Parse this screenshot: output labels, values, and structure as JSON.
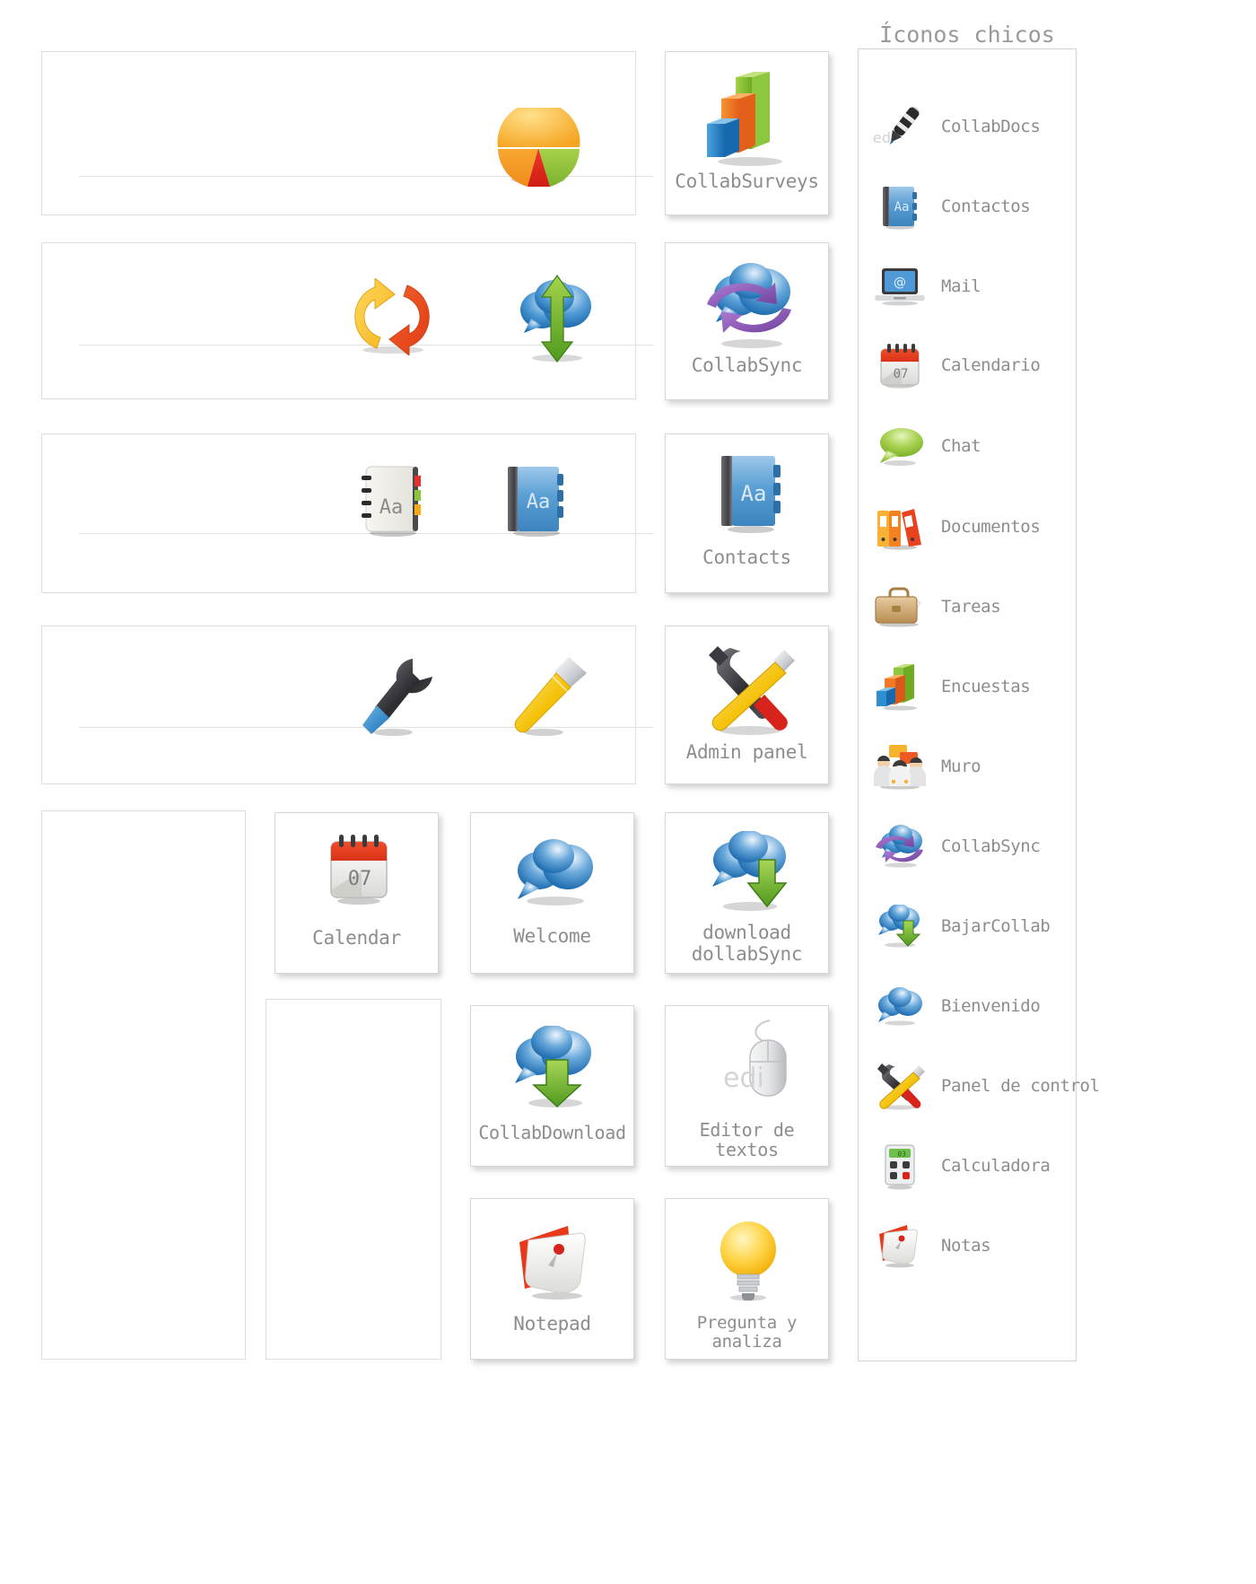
{
  "sidebar": {
    "title": "Íconos chicos",
    "items": [
      {
        "label": "CollabDocs",
        "icon": "pen-icon"
      },
      {
        "label": "Contactos",
        "icon": "address-book-icon"
      },
      {
        "label": "Mail",
        "icon": "laptop-mail-icon"
      },
      {
        "label": "Calendario",
        "icon": "calendar-icon"
      },
      {
        "label": "Chat",
        "icon": "speech-bubble-icon"
      },
      {
        "label": "Documentos",
        "icon": "binders-icon"
      },
      {
        "label": "Tareas",
        "icon": "briefcase-icon"
      },
      {
        "label": "Encuestas",
        "icon": "bar-chart-icon"
      },
      {
        "label": "Muro",
        "icon": "people-group-icon"
      },
      {
        "label": "CollabSync",
        "icon": "cloud-sync-icon"
      },
      {
        "label": "BajarCollab",
        "icon": "cloud-download-icon"
      },
      {
        "label": "Bienvenido",
        "icon": "cloud-icon"
      },
      {
        "label": "Panel de control",
        "icon": "tools-icon"
      },
      {
        "label": "Calculadora",
        "icon": "calculator-icon"
      },
      {
        "label": "Notas",
        "icon": "notes-icon"
      }
    ]
  },
  "rows": [
    {
      "name": "surveys-row",
      "sketch_icons": [
        "pie-chart-3d-icon"
      ],
      "card": {
        "label": "CollabSurveys",
        "icon": "bar-chart-3d-icon"
      }
    },
    {
      "name": "sync-row",
      "sketch_icons": [
        "refresh-arrows-icon",
        "cloud-updown-icon"
      ],
      "card": {
        "label": "CollabSync",
        "icon": "cloud-sync-big-icon"
      }
    },
    {
      "name": "contacts-row",
      "sketch_icons": [
        "notebook-aa-icon",
        "book-aa-blue-icon"
      ],
      "card": {
        "label": "Contacts",
        "icon": "book-aa-big-icon"
      }
    },
    {
      "name": "admin-row",
      "sketch_icons": [
        "wrench-icon",
        "screwdriver-icon"
      ],
      "card": {
        "label": "Admin panel",
        "icon": "tools-big-icon"
      }
    }
  ],
  "grid": {
    "cards": [
      {
        "label": "Calendar",
        "icon": "calendar-big-icon",
        "col": 1,
        "row": 1
      },
      {
        "label": "Welcome",
        "icon": "cloud-big-icon",
        "col": 2,
        "row": 1
      },
      {
        "label": "download\ndollabSync",
        "icon": "cloud-download-big-icon",
        "col": 3,
        "row": 1
      },
      {
        "label": "CollabDownload",
        "icon": "cloud-download-big2-icon",
        "col": 2,
        "row": 2
      },
      {
        "label": "Editor de textos",
        "icon": "mouse-edi-icon",
        "col": 3,
        "row": 2
      },
      {
        "label": "Notepad",
        "icon": "notepad-big-icon",
        "col": 2,
        "row": 3
      },
      {
        "label": "Pregunta y analiza",
        "icon": "lightbulb-icon",
        "col": 3,
        "row": 3
      }
    ]
  },
  "colors": {
    "label_gray": "#8d8d8d",
    "card_border": "#d7d7d7",
    "strip_border": "#dedede",
    "hairline": "#e2e2e2",
    "orange": "#f07d1e",
    "green": "#8cc63f",
    "blue": "#2b7fc4",
    "red": "#e02b20",
    "yellow": "#fbc02d",
    "purple": "#8e57b5"
  }
}
